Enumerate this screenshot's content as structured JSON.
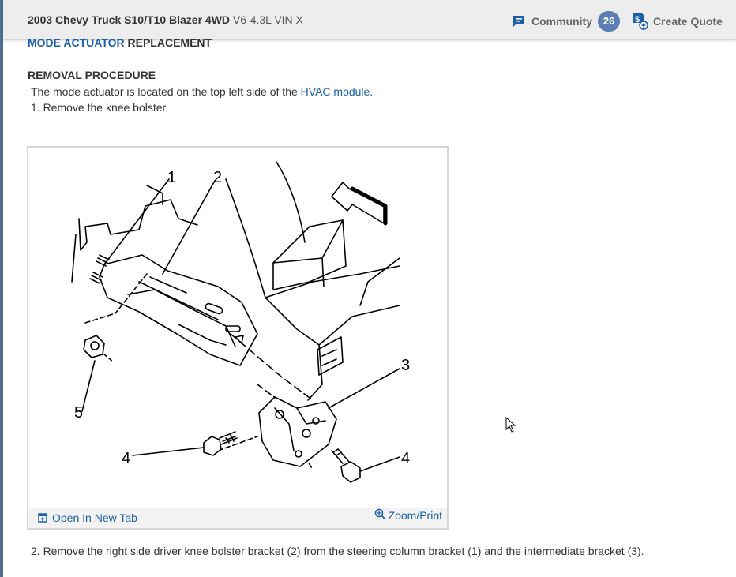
{
  "header": {
    "vehicle_bold": "2003 Chevy Truck S10/T10 Blazer 4WD",
    "vehicle_engine": " V6-4.3L VIN X",
    "community_label": "Community",
    "community_count": "26",
    "quote_label": "Create Quote"
  },
  "article": {
    "title_link": "MODE ACTUATOR",
    "title_rest": " REPLACEMENT",
    "section": "REMOVAL PROCEDURE",
    "intro_before": "The mode actuator is located on the top left side of the ",
    "intro_link": "HVAC module.",
    "step1": "1. Remove the knee bolster.",
    "step2": "2. Remove the right side driver knee bolster bracket (2) from the steering column bracket (1) and the intermediate bracket (3)."
  },
  "figure": {
    "callouts": [
      "1",
      "2",
      "3",
      "4",
      "4",
      "5"
    ],
    "open_tab_label": "Open In New Tab",
    "zoom_label": "Zoom/Print"
  },
  "icons": {
    "community": "chat-icon",
    "quote": "dollar-document-icon",
    "open_tab": "open-window-icon",
    "zoom": "magnifier-plus-icon"
  },
  "colors": {
    "link": "#1a5fa8",
    "badge": "#5b7fb0",
    "header_bg": "#ededed"
  }
}
